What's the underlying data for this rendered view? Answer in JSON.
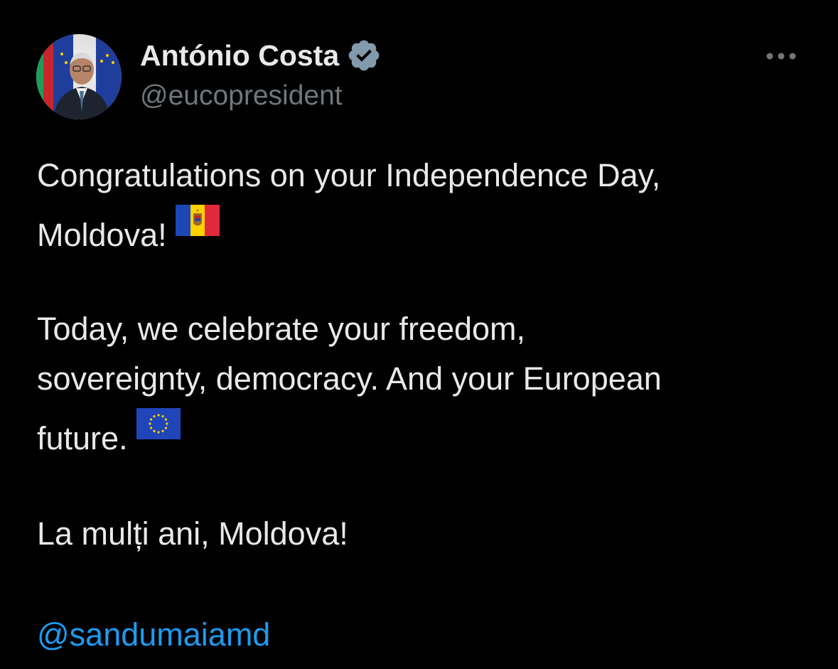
{
  "author": {
    "display_name": "António Costa",
    "handle": "@eucopresident",
    "avatar_icon": "profile-photo",
    "verified_icon": "verified-badge-icon"
  },
  "menu": {
    "icon": "more-options-icon"
  },
  "post": {
    "paragraph1_line1": "Congratulations on your Independence Day,",
    "paragraph1_line2": "Moldova!",
    "paragraph1_emoji": "moldova-flag-icon",
    "paragraph2_line1": "Today, we celebrate your freedom,",
    "paragraph2_line2": "sovereignty, democracy. And your European",
    "paragraph2_line3": "future.",
    "paragraph2_emoji": "eu-flag-icon",
    "paragraph3": "La mulți ani, Moldova!",
    "mention": "@sandumaiamd"
  },
  "colors": {
    "background": "#000000",
    "text_primary": "#e7e9ea",
    "text_secondary": "#71767b",
    "link": "#1d9bf0",
    "verified_badge": "#829aab"
  }
}
